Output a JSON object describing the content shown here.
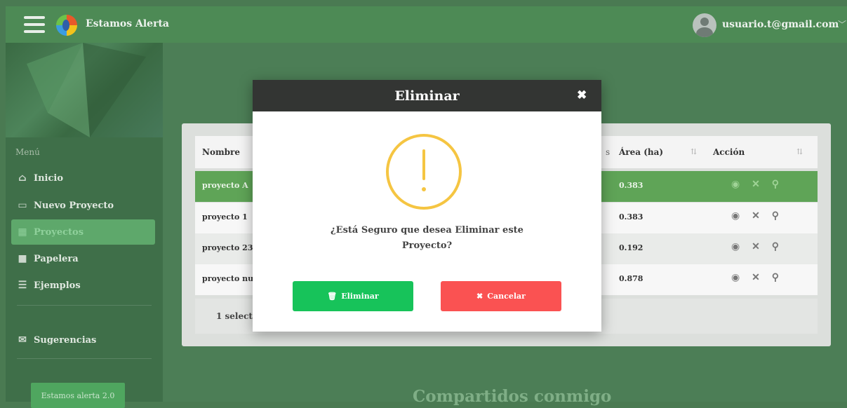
{
  "header": {
    "brand": "Estamos Alerta",
    "user_email": "usuario.t@gmail.com",
    "chevron": "﹀"
  },
  "sidebar": {
    "menu_label": "Menú",
    "items": [
      {
        "label": "Inicio",
        "icon": "home-icon",
        "glyph": "⌂"
      },
      {
        "label": "Nuevo Proyecto",
        "icon": "new-project-icon",
        "glyph": "▭"
      },
      {
        "label": "Proyectos",
        "icon": "grid-icon",
        "glyph": "▦"
      },
      {
        "label": "Papelera",
        "icon": "trash-grid-icon",
        "glyph": "■"
      },
      {
        "label": "Ejemplos",
        "icon": "list-icon",
        "glyph": "☰"
      },
      {
        "label": "Sugerencias",
        "icon": "mail-icon",
        "glyph": "✉"
      }
    ],
    "footer_button": "Estamos alerta 2.0"
  },
  "table": {
    "columns": {
      "name": "Nombre",
      "area": "Área (ha)",
      "action": "Acción",
      "partial": "s"
    },
    "rows": [
      {
        "name": "proyecto A",
        "area": "0.383"
      },
      {
        "name": "proyecto 1",
        "area": "0.383"
      },
      {
        "name": "proyecto 23",
        "area": "0.192"
      },
      {
        "name": "proyecto nu",
        "area": "0.878"
      }
    ],
    "footer": "1 selecte",
    "actions_glyphs": "◉ ✕ ⚲"
  },
  "shared_title": "Compartidos conmigo",
  "modal": {
    "title": "Eliminar",
    "close": "✖",
    "message": "¿Está Seguro que desea Eliminar este Proyecto?",
    "delete_label": "Eliminar",
    "delete_glyph": "🗑",
    "cancel_label": "Cancelar",
    "cancel_glyph": "✖"
  },
  "colors": {
    "header": "#4d8a55",
    "sidebar": "#3f6f49",
    "active_item": "#5ea86b",
    "selected_row": "#5fa457",
    "delete_button": "#17c35a",
    "cancel_button": "#fa5252",
    "warning": "#f5c542"
  }
}
